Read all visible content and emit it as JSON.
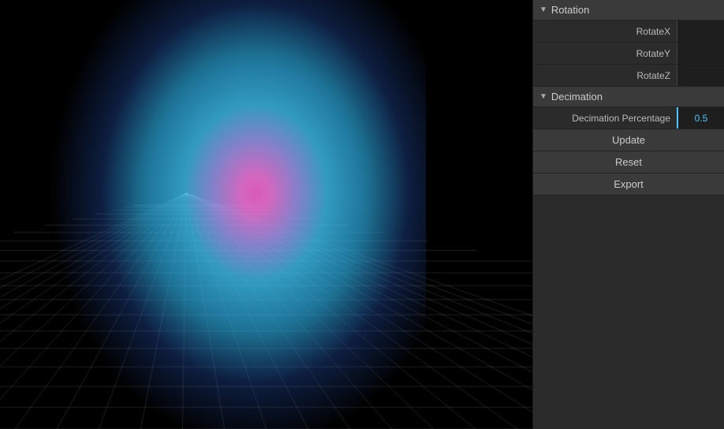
{
  "panel": {
    "rotation": {
      "label": "Rotation",
      "items": [
        {
          "id": "rotate-x",
          "label": "RotateX",
          "value": ""
        },
        {
          "id": "rotate-y",
          "label": "RotateY",
          "value": ""
        },
        {
          "id": "rotate-z",
          "label": "RotateZ",
          "value": ""
        }
      ]
    },
    "decimation": {
      "label": "Decimation",
      "percentage_label": "Decimation Percentage",
      "percentage_value": "0.5",
      "buttons": [
        {
          "id": "update-btn",
          "label": "Update"
        },
        {
          "id": "reset-btn",
          "label": "Reset"
        },
        {
          "id": "export-btn",
          "label": "Export"
        }
      ]
    }
  },
  "colors": {
    "panel_bg": "#2b2b2b",
    "header_bg": "#3a3a3a",
    "accent": "#4fc3f7",
    "text": "#bbb",
    "border": "#222"
  }
}
